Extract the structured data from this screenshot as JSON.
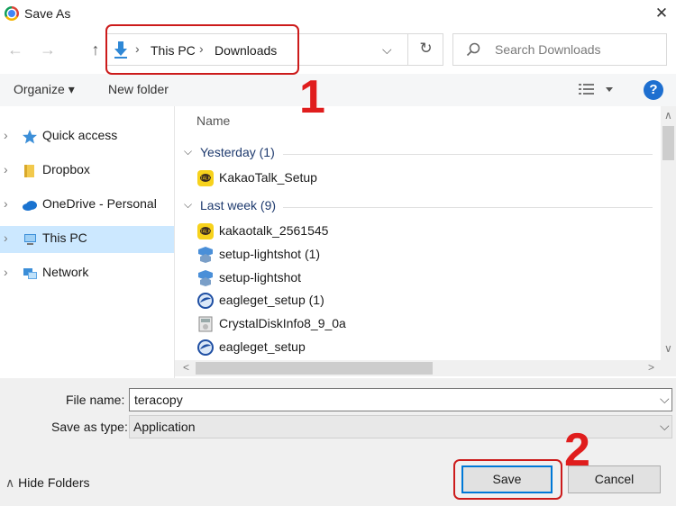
{
  "window": {
    "title": "Save As",
    "close_glyph": "✕"
  },
  "nav": {
    "back_glyph": "←",
    "forward_glyph": "→",
    "up_glyph": "↑"
  },
  "address": {
    "crumbs": [
      "This PC",
      "Downloads"
    ],
    "separator": "›",
    "refresh_glyph": "↻",
    "dropdown_glyph": "⌵"
  },
  "search": {
    "placeholder": "Search Downloads",
    "icon": "search-icon"
  },
  "toolbar": {
    "organize_label": "Organize ▾",
    "new_folder_label": "New folder",
    "help_glyph": "?"
  },
  "sidebar": {
    "items": [
      {
        "label": "Quick access",
        "icon": "star-icon",
        "selected": false
      },
      {
        "label": "Dropbox",
        "icon": "folder-icon",
        "selected": false
      },
      {
        "label": "OneDrive - Personal",
        "icon": "cloud-icon",
        "selected": false
      },
      {
        "label": "This PC",
        "icon": "computer-icon",
        "selected": true
      },
      {
        "label": "Network",
        "icon": "network-icon",
        "selected": false
      }
    ]
  },
  "files": {
    "column_name": "Name",
    "groups": [
      {
        "label": "Yesterday (1)",
        "items": [
          {
            "name": "KakaoTalk_Setup",
            "icon": "kakao-icon"
          }
        ]
      },
      {
        "label": "Last week (9)",
        "items": [
          {
            "name": "kakaotalk_2561545",
            "icon": "kakao-icon"
          },
          {
            "name": "setup-lightshot (1)",
            "icon": "lightshot-icon"
          },
          {
            "name": "setup-lightshot",
            "icon": "lightshot-icon"
          },
          {
            "name": "eagleget_setup (1)",
            "icon": "eagleget-icon"
          },
          {
            "name": "CrystalDiskInfo8_9_0a",
            "icon": "crystaldisk-icon"
          },
          {
            "name": "eagleget_setup",
            "icon": "eagleget-icon"
          }
        ]
      }
    ]
  },
  "form": {
    "file_name_label": "File name:",
    "file_name_value": "teracopy",
    "save_type_label": "Save as type:",
    "save_type_value": "Application"
  },
  "footer": {
    "hide_folders_label": "Hide Folders",
    "save_label": "Save",
    "cancel_label": "Cancel"
  },
  "annotations": {
    "step1": "1",
    "step2": "2",
    "color": "#e01d1d"
  }
}
